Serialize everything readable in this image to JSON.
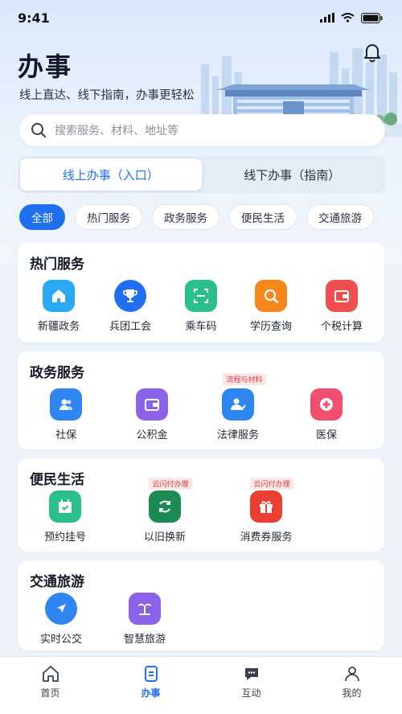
{
  "status_bar": {
    "time": "9:41"
  },
  "header": {
    "title": "办事",
    "subtitle": "线上直达、线下指南，办事更轻松"
  },
  "search": {
    "placeholder": "搜索服务、材料、地址等"
  },
  "segments": [
    {
      "label": "线上办事（入口）",
      "active": true
    },
    {
      "label": "线下办事（指南）",
      "active": false
    }
  ],
  "chips": [
    "全部",
    "热门服务",
    "政务服务",
    "便民生活",
    "交通旅游"
  ],
  "sections": {
    "hot": {
      "title": "热门服务",
      "items": [
        {
          "label": "新疆政务",
          "icon": "home-icon",
          "color": "#2aa8f2"
        },
        {
          "label": "兵团工会",
          "icon": "trophy-icon",
          "color": "#1f6ff0"
        },
        {
          "label": "乘车码",
          "icon": "scan-icon",
          "color": "#2bbf8e"
        },
        {
          "label": "学历查询",
          "icon": "search-icon",
          "color": "#f7861c"
        },
        {
          "label": "个税计算",
          "icon": "wallet-icon",
          "color": "#ef4f4f"
        }
      ]
    },
    "gov": {
      "title": "政务服务",
      "items": [
        {
          "label": "社保",
          "icon": "people-icon",
          "color": "#2f86f0"
        },
        {
          "label": "公积金",
          "icon": "wallet-icon",
          "color": "#8a63e8"
        },
        {
          "label": "法律服务",
          "icon": "user-check-icon",
          "color": "#2f86f0",
          "tag": "流程与材料"
        },
        {
          "label": "医保",
          "icon": "medical-plus-icon",
          "color": "#f0506d"
        }
      ]
    },
    "life": {
      "title": "便民生活",
      "items": [
        {
          "label": "预约挂号",
          "icon": "calendar-check-icon",
          "color": "#2bbf8e"
        },
        {
          "label": "以旧换新",
          "icon": "refresh-icon",
          "color": "#1c8a52",
          "tag": "云闪付办理"
        },
        {
          "label": "消费券服务",
          "icon": "gift-icon",
          "color": "#ea3f32",
          "tag": "云闪付办理"
        }
      ]
    },
    "travel": {
      "title": "交通旅游",
      "items": [
        {
          "label": "实时公交",
          "icon": "navigation-icon",
          "color": "#2f86f0"
        },
        {
          "label": "智慧旅游",
          "icon": "palm-tree-icon",
          "color": "#8a63e8"
        }
      ]
    }
  },
  "tabbar": [
    {
      "label": "首页",
      "icon": "home-outline-icon",
      "active": false
    },
    {
      "label": "办事",
      "icon": "document-icon",
      "active": true
    },
    {
      "label": "互动",
      "icon": "chat-icon",
      "active": false
    },
    {
      "label": "我的",
      "icon": "user-icon",
      "active": false
    }
  ]
}
